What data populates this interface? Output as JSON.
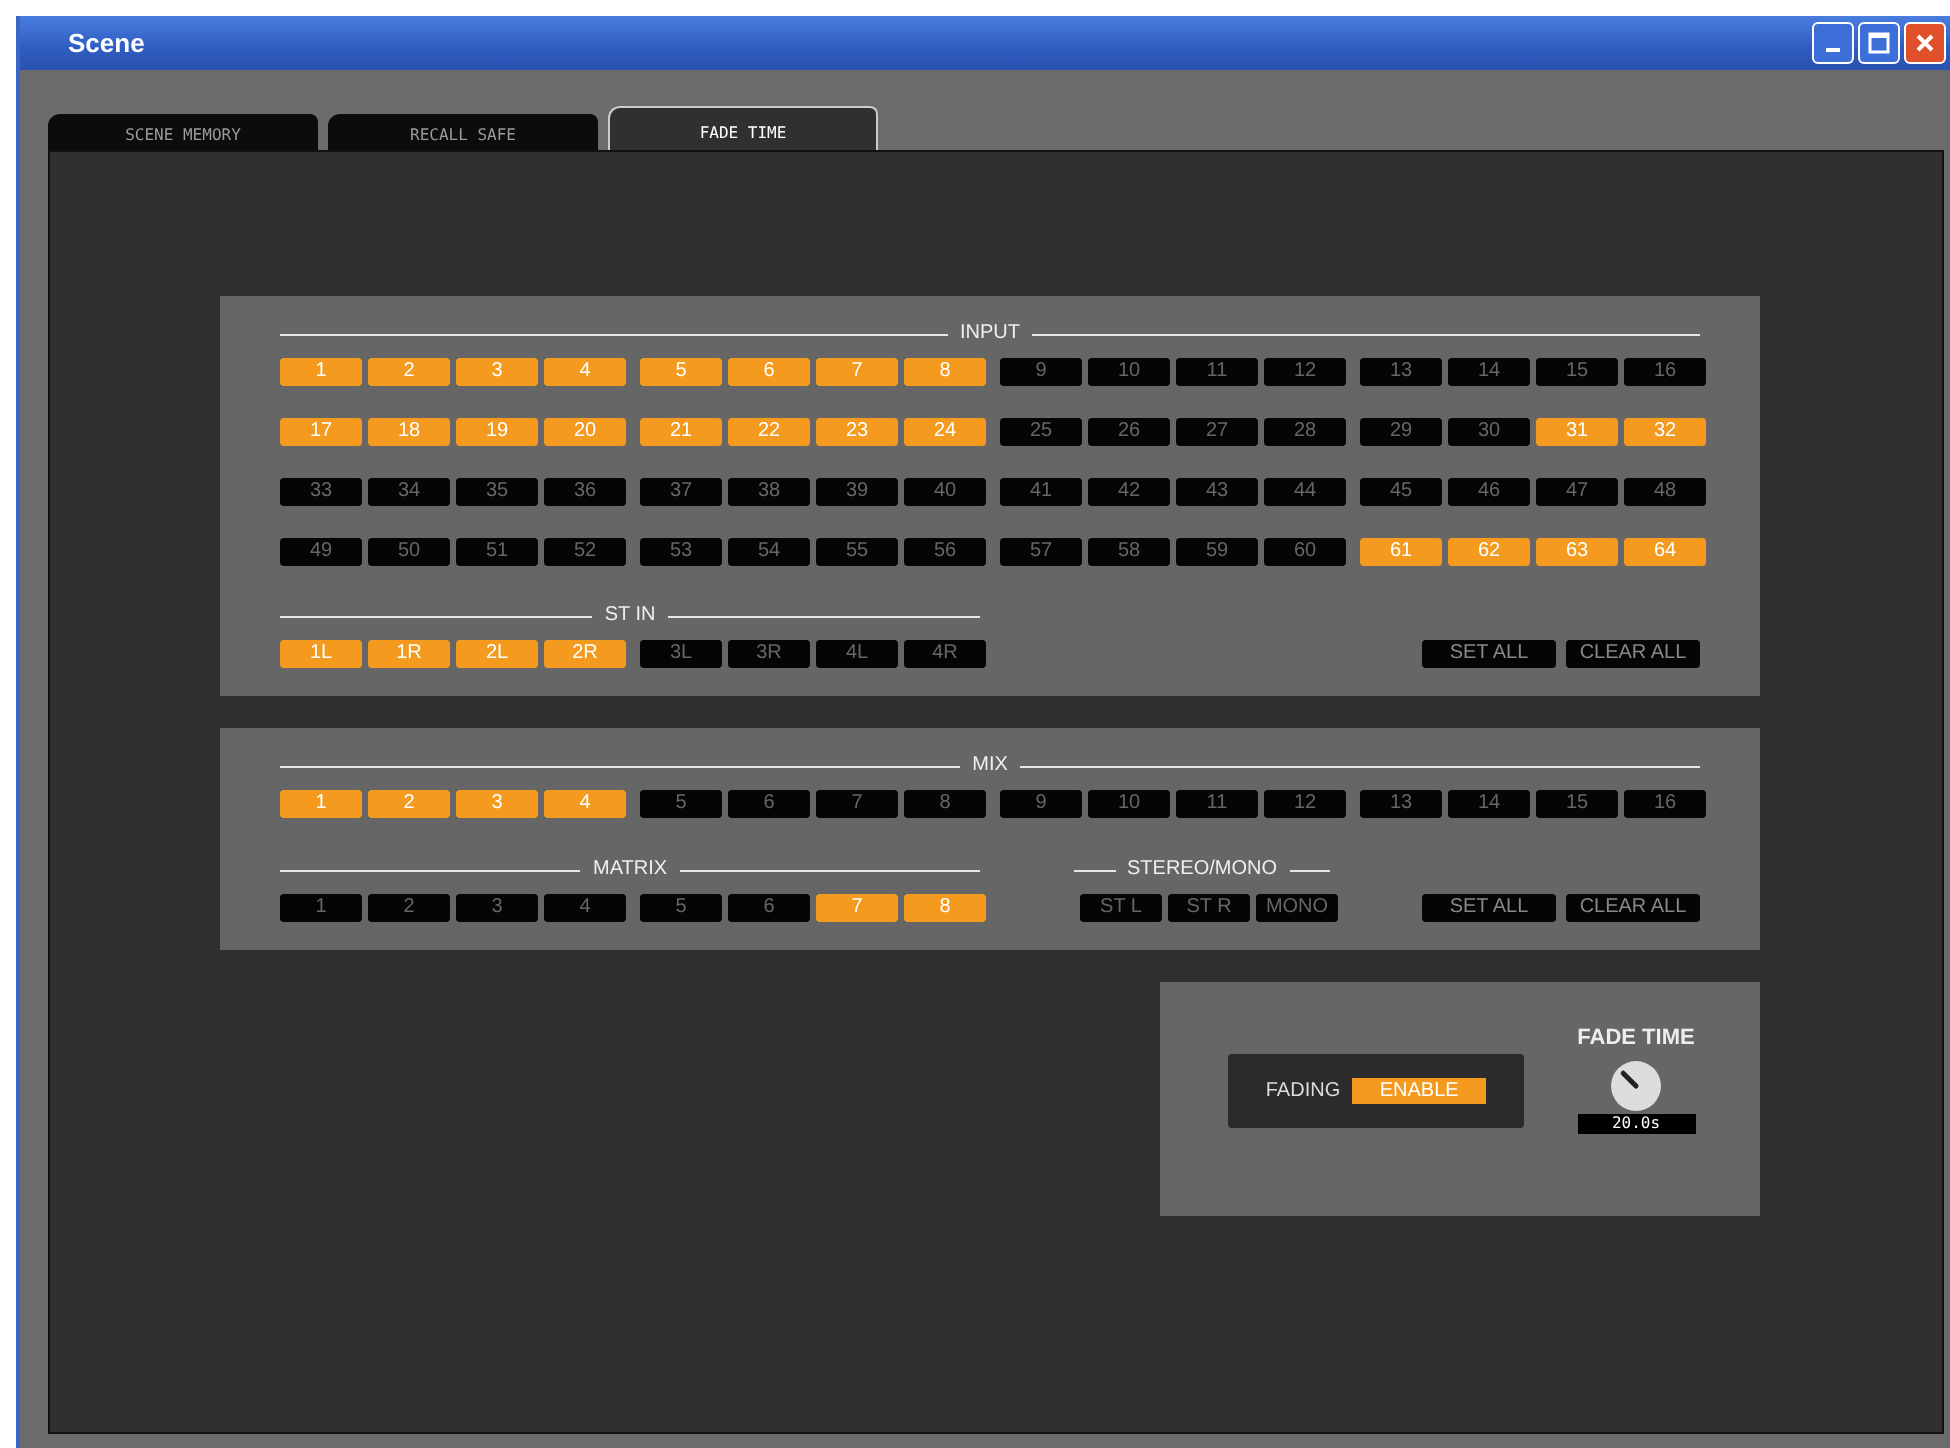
{
  "window": {
    "title": "Scene"
  },
  "tabs": [
    {
      "label": "SCENE MEMORY",
      "selected": false
    },
    {
      "label": "RECALL SAFE",
      "selected": false
    },
    {
      "label": "FADE TIME",
      "selected": true
    }
  ],
  "input": {
    "title": "INPUT",
    "channels": [
      {
        "label": "1",
        "on": true
      },
      {
        "label": "2",
        "on": true
      },
      {
        "label": "3",
        "on": true
      },
      {
        "label": "4",
        "on": true
      },
      {
        "label": "5",
        "on": true
      },
      {
        "label": "6",
        "on": true
      },
      {
        "label": "7",
        "on": true
      },
      {
        "label": "8",
        "on": true
      },
      {
        "label": "9",
        "on": false
      },
      {
        "label": "10",
        "on": false
      },
      {
        "label": "11",
        "on": false
      },
      {
        "label": "12",
        "on": false
      },
      {
        "label": "13",
        "on": false
      },
      {
        "label": "14",
        "on": false
      },
      {
        "label": "15",
        "on": false
      },
      {
        "label": "16",
        "on": false
      },
      {
        "label": "17",
        "on": true
      },
      {
        "label": "18",
        "on": true
      },
      {
        "label": "19",
        "on": true
      },
      {
        "label": "20",
        "on": true
      },
      {
        "label": "21",
        "on": true
      },
      {
        "label": "22",
        "on": true
      },
      {
        "label": "23",
        "on": true
      },
      {
        "label": "24",
        "on": true
      },
      {
        "label": "25",
        "on": false
      },
      {
        "label": "26",
        "on": false
      },
      {
        "label": "27",
        "on": false
      },
      {
        "label": "28",
        "on": false
      },
      {
        "label": "29",
        "on": false
      },
      {
        "label": "30",
        "on": false
      },
      {
        "label": "31",
        "on": true
      },
      {
        "label": "32",
        "on": true
      },
      {
        "label": "33",
        "on": false
      },
      {
        "label": "34",
        "on": false
      },
      {
        "label": "35",
        "on": false
      },
      {
        "label": "36",
        "on": false
      },
      {
        "label": "37",
        "on": false
      },
      {
        "label": "38",
        "on": false
      },
      {
        "label": "39",
        "on": false
      },
      {
        "label": "40",
        "on": false
      },
      {
        "label": "41",
        "on": false
      },
      {
        "label": "42",
        "on": false
      },
      {
        "label": "43",
        "on": false
      },
      {
        "label": "44",
        "on": false
      },
      {
        "label": "45",
        "on": false
      },
      {
        "label": "46",
        "on": false
      },
      {
        "label": "47",
        "on": false
      },
      {
        "label": "48",
        "on": false
      },
      {
        "label": "49",
        "on": false
      },
      {
        "label": "50",
        "on": false
      },
      {
        "label": "51",
        "on": false
      },
      {
        "label": "52",
        "on": false
      },
      {
        "label": "53",
        "on": false
      },
      {
        "label": "54",
        "on": false
      },
      {
        "label": "55",
        "on": false
      },
      {
        "label": "56",
        "on": false
      },
      {
        "label": "57",
        "on": false
      },
      {
        "label": "58",
        "on": false
      },
      {
        "label": "59",
        "on": false
      },
      {
        "label": "60",
        "on": false
      },
      {
        "label": "61",
        "on": true
      },
      {
        "label": "62",
        "on": true
      },
      {
        "label": "63",
        "on": true
      },
      {
        "label": "64",
        "on": true
      }
    ],
    "st_in": {
      "title": "ST IN",
      "channels": [
        {
          "label": "1L",
          "on": true
        },
        {
          "label": "1R",
          "on": true
        },
        {
          "label": "2L",
          "on": true
        },
        {
          "label": "2R",
          "on": true
        },
        {
          "label": "3L",
          "on": false
        },
        {
          "label": "3R",
          "on": false
        },
        {
          "label": "4L",
          "on": false
        },
        {
          "label": "4R",
          "on": false
        }
      ]
    },
    "buttons": [
      "SET ALL",
      "CLEAR ALL"
    ]
  },
  "mix": {
    "title": "MIX",
    "channels": [
      {
        "label": "1",
        "on": true
      },
      {
        "label": "2",
        "on": true
      },
      {
        "label": "3",
        "on": true
      },
      {
        "label": "4",
        "on": true
      },
      {
        "label": "5",
        "on": false
      },
      {
        "label": "6",
        "on": false
      },
      {
        "label": "7",
        "on": false
      },
      {
        "label": "8",
        "on": false
      },
      {
        "label": "9",
        "on": false
      },
      {
        "label": "10",
        "on": false
      },
      {
        "label": "11",
        "on": false
      },
      {
        "label": "12",
        "on": false
      },
      {
        "label": "13",
        "on": false
      },
      {
        "label": "14",
        "on": false
      },
      {
        "label": "15",
        "on": false
      },
      {
        "label": "16",
        "on": false
      }
    ],
    "matrix": {
      "title": "MATRIX",
      "channels": [
        {
          "label": "1",
          "on": false
        },
        {
          "label": "2",
          "on": false
        },
        {
          "label": "3",
          "on": false
        },
        {
          "label": "4",
          "on": false
        },
        {
          "label": "5",
          "on": false
        },
        {
          "label": "6",
          "on": false
        },
        {
          "label": "7",
          "on": true
        },
        {
          "label": "8",
          "on": true
        }
      ]
    },
    "stereo_mono": {
      "title": "STEREO/MONO",
      "channels": [
        {
          "label": "ST L",
          "on": false
        },
        {
          "label": "ST R",
          "on": false
        },
        {
          "label": "MONO",
          "on": false
        }
      ]
    },
    "buttons": [
      "SET ALL",
      "CLEAR ALL"
    ]
  },
  "fade": {
    "fading_label": "FADING",
    "enable": {
      "label": "ENABLE",
      "on": true
    },
    "fade_time_title": "FADE TIME",
    "value": "20.0s"
  }
}
